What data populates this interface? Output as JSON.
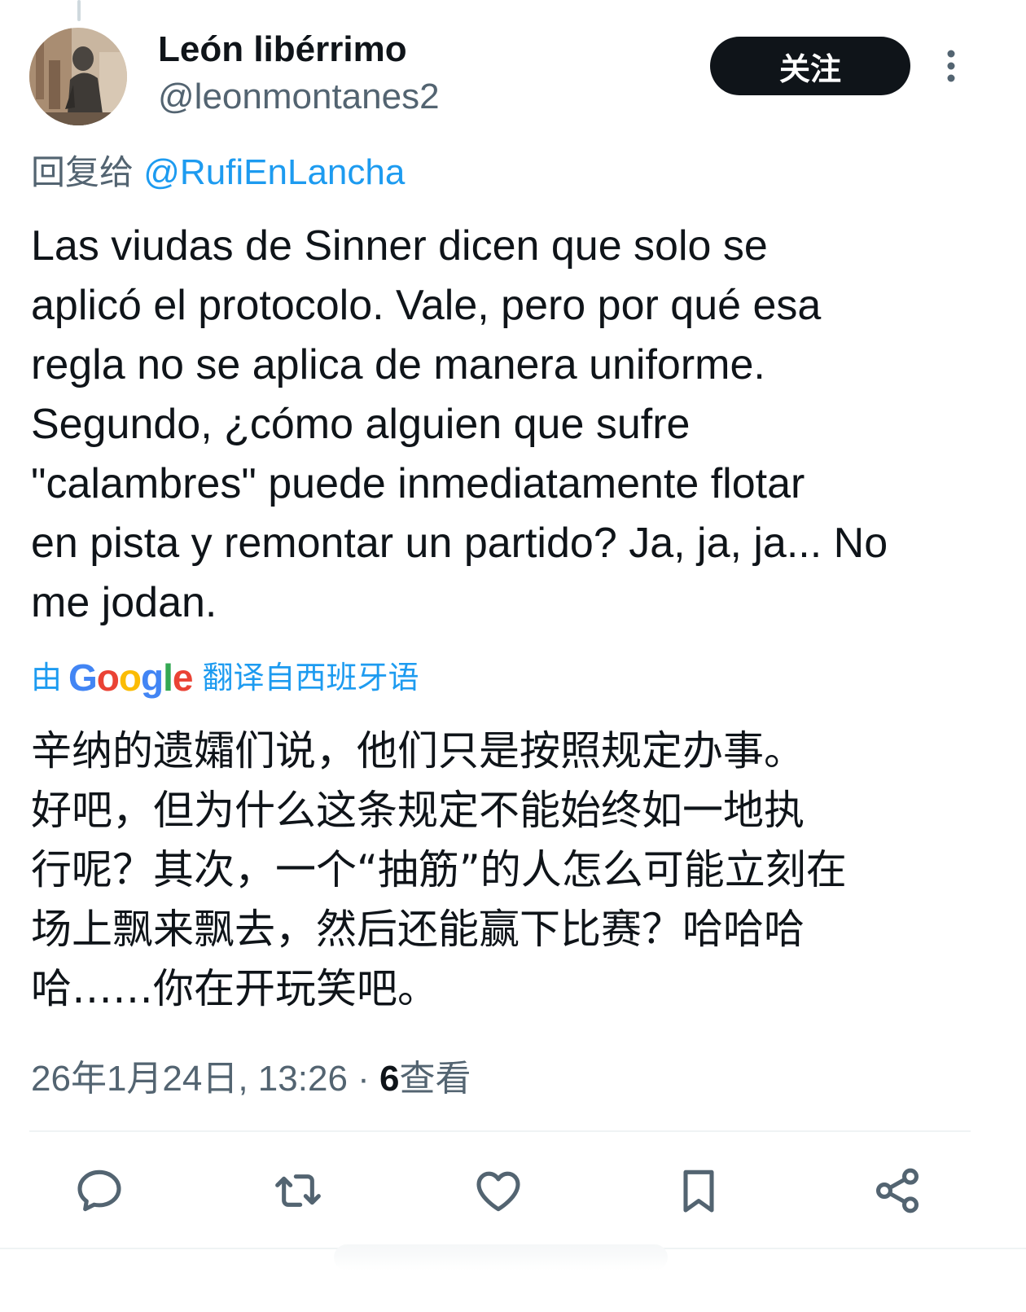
{
  "user": {
    "display_name": "León libérrimo",
    "handle": "@leonmontanes2"
  },
  "follow_label": "关注",
  "reply": {
    "prefix": "回复给",
    "handle": "@RufiEnLancha"
  },
  "tweet_text": "Las viudas de Sinner dicen que solo se\naplicó el protocolo. Vale, pero por qué esa\nregla no se aplica de manera uniforme.\nSegundo, ¿cómo alguien que sufre\n\"calambres\" puede inmediatamente flotar\nen pista y remontar un partido? Ja, ja, ja... No\nme jodan.",
  "translation": {
    "prefix": "由",
    "provider": "Google",
    "suffix": "翻译自西班牙语",
    "text": "辛纳的遗孀们说，他们只是按照规定办事。\n好吧，但为什么这条规定不能始终如一地执\n行呢？其次，一个“抽筋”的人怎么可能立刻在\n场上飘来飘去，然后还能赢下比赛？哈哈哈\n哈……你在开玩笑吧。"
  },
  "meta": {
    "timestamp": "26年1月24日, 13:26",
    "separator": " · ",
    "views_count": "6",
    "views_label": "查看"
  },
  "actions": {
    "icons": [
      "reply-icon",
      "retweet-icon",
      "like-icon",
      "bookmark-icon",
      "share-icon"
    ]
  },
  "colors": {
    "accent": "#1d9bf0",
    "text_primary": "#0f1419",
    "text_secondary": "#536471",
    "icon": "#536471",
    "follow_bg": "#0f1419",
    "google_blue": "#4285F4",
    "google_red": "#EA4335",
    "google_yellow": "#FBBC05",
    "google_green": "#34A853"
  }
}
